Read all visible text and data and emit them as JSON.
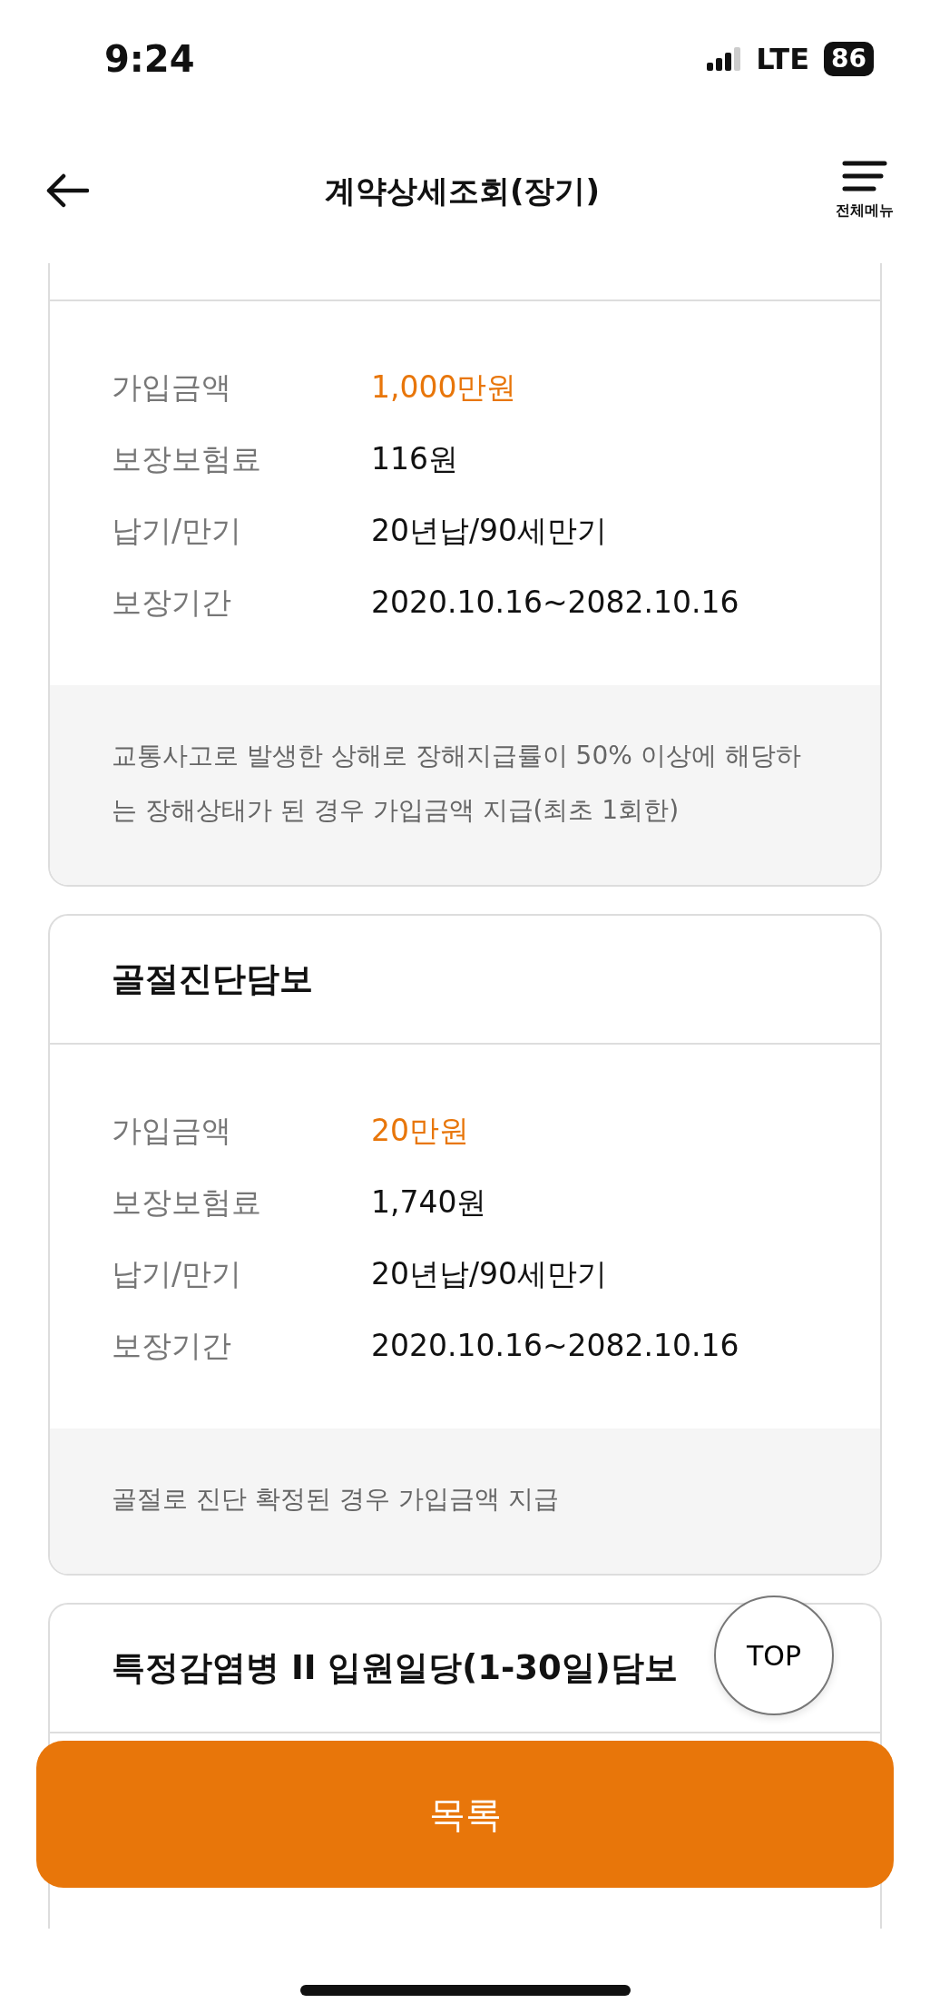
{
  "status_bar": {
    "time": "9:24",
    "network": "LTE",
    "battery": "86"
  },
  "header": {
    "title": "계약상세조회(장기)",
    "menu_label": "전체메뉴"
  },
  "cards": [
    {
      "rows": [
        {
          "label": "가입금액",
          "value": "1,000만원",
          "kind": "amount"
        },
        {
          "label": "보장보험료",
          "value": "116원",
          "kind": "plain"
        },
        {
          "label": "납기/만기",
          "value": "20년납/90세만기",
          "kind": "plain"
        },
        {
          "label": "보장기간",
          "value": "2020.10.16~2082.10.16",
          "kind": "plain"
        }
      ],
      "description": "교통사고로 발생한 상해로 장해지급률이 50% 이상에 해당하는 장해상태가 된 경우 가입금액 지급(최초 1회한)"
    },
    {
      "title": "골절진단담보",
      "rows": [
        {
          "label": "가입금액",
          "value": "20만원",
          "kind": "amount"
        },
        {
          "label": "보장보험료",
          "value": "1,740원",
          "kind": "plain"
        },
        {
          "label": "납기/만기",
          "value": "20년납/90세만기",
          "kind": "plain"
        },
        {
          "label": "보장기간",
          "value": "2020.10.16~2082.10.16",
          "kind": "plain"
        }
      ],
      "description": "골절로 진단 확정된 경우 가입금액 지급"
    },
    {
      "title": "특정감염병 II 입원일당(1-30일)담보"
    }
  ],
  "top_button": "TOP",
  "list_button": "목록"
}
